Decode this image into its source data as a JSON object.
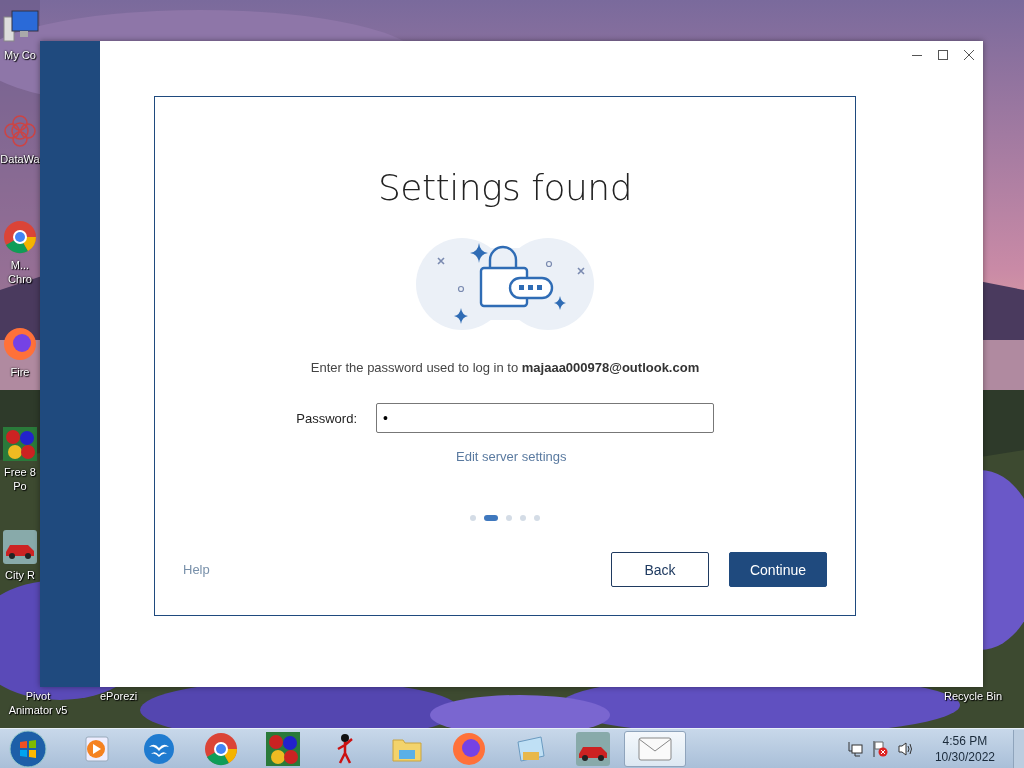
{
  "desktop_icons": [
    {
      "kind": "computer",
      "lines": [
        "My Co"
      ]
    },
    {
      "kind": "flower",
      "lines": [
        "DataWa"
      ]
    },
    {
      "kind": "chrome",
      "lines": [
        "M...",
        "Chro"
      ]
    },
    {
      "kind": "firefox",
      "lines": [
        "Fire"
      ]
    },
    {
      "kind": "balls",
      "lines": [
        "Free 8",
        "Po"
      ]
    },
    {
      "kind": "car",
      "lines": [
        "City R"
      ]
    },
    {
      "kind": "none",
      "lines": [
        "Pivot",
        "Animator v5"
      ]
    }
  ],
  "desktop_labels": [
    "ePorezi",
    "Recycle Bin"
  ],
  "window": {
    "dialog": {
      "title": "Settings found",
      "description": "Enter the password used to log in to **majaaa000978@outlook.com**",
      "password_label": "Password:",
      "password_value": "•",
      "link": "Edit server settings",
      "steps": [
        {
          "selected": false
        },
        {
          "selected": true
        },
        {
          "selected": false
        },
        {
          "selected": false
        },
        {
          "selected": false
        }
      ],
      "help": "Help",
      "back": "Back",
      "continue": "Continue"
    }
  },
  "taskbar": {
    "items": [
      {
        "kind": "media",
        "selected": false
      },
      {
        "kind": "birds",
        "selected": false
      },
      {
        "kind": "chrome",
        "selected": false
      },
      {
        "kind": "balls",
        "selected": false
      },
      {
        "kind": "figure",
        "selected": false
      },
      {
        "kind": "folder",
        "selected": false
      },
      {
        "kind": "firefox",
        "selected": false
      },
      {
        "kind": "picture",
        "selected": false
      },
      {
        "kind": "car",
        "selected": false
      },
      {
        "kind": "mail",
        "selected": true
      }
    ],
    "time": "4:56 PM",
    "date": "10/30/2022"
  }
}
